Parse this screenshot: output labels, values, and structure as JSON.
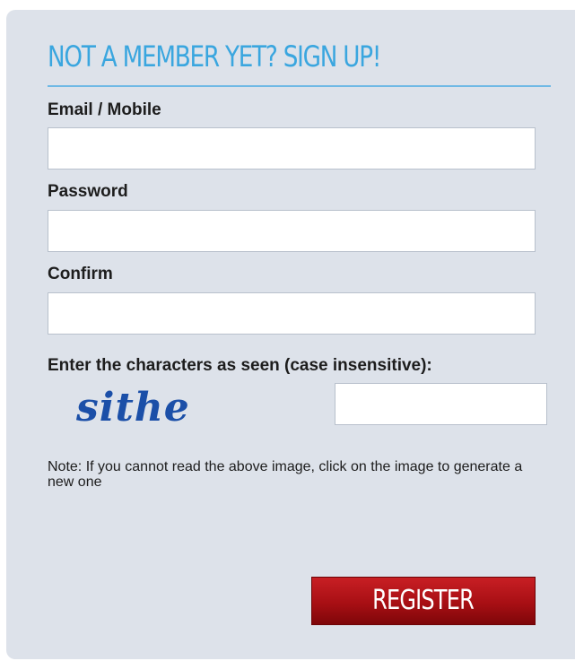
{
  "form": {
    "heading": "NOT A MEMBER YET? SIGN UP!",
    "email_label": "Email / Mobile",
    "email_value": "",
    "password_label": "Password",
    "password_value": "",
    "confirm_label": "Confirm",
    "confirm_value": "",
    "captcha_label": "Enter the characters as seen (case insensitive):",
    "captcha_text": "sithe",
    "captcha_value": "",
    "note": "Note: If you cannot read the above image, click on the image to generate a new one",
    "register_label": "REGISTER"
  },
  "colors": {
    "panel_bg": "#dde2ea",
    "heading": "#3aa6df",
    "captcha": "#1b4fa8",
    "button": "#a80f14"
  }
}
